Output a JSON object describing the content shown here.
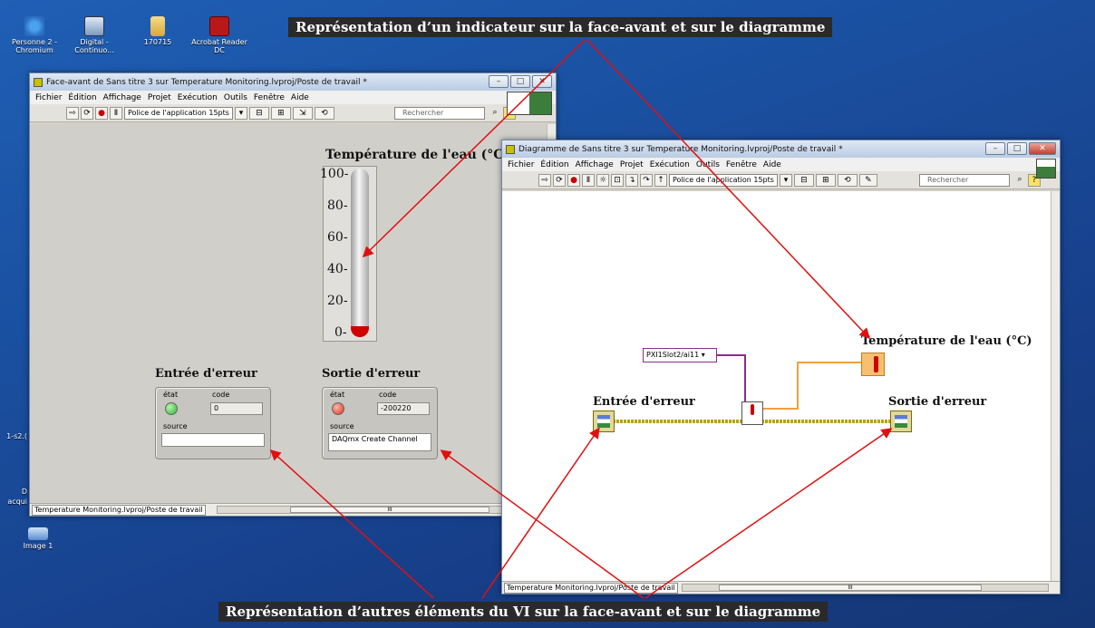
{
  "desktop": {
    "icons": [
      {
        "label": "Personne 2 - Chromium",
        "icon": "chromium-icon"
      },
      {
        "label": "Digital - Continuo...",
        "icon": "computer-icon"
      },
      {
        "label": "170715",
        "icon": "folder-icon"
      },
      {
        "label": "Acrobat Reader DC",
        "icon": "acrobat-icon"
      },
      {
        "label": "Image 1",
        "icon": "image-icon"
      }
    ],
    "edge_texts": [
      "1-s2.(",
      "D",
      "acqui"
    ]
  },
  "captions": {
    "top": "Représentation d’un indicateur sur la face-avant et sur le diagramme",
    "bottom": "Représentation d’autres éléments du VI sur la face-avant et sur le diagramme"
  },
  "front_panel": {
    "title": "Face-avant de Sans titre 3 sur Temperature Monitoring.lvproj/Poste de travail *",
    "menu": [
      "Fichier",
      "Édition",
      "Affichage",
      "Projet",
      "Exécution",
      "Outils",
      "Fenêtre",
      "Aide"
    ],
    "font_select": "Police de l'application 15pts",
    "search_placeholder": "Rechercher",
    "thermometer": {
      "label": "Température de l'eau (°C)",
      "ticks": [
        "100-",
        "80-",
        "60-",
        "40-",
        "20-",
        "0-"
      ],
      "value": 0
    },
    "error_in": {
      "label": "Entrée d'erreur",
      "status_label": "état",
      "code_label": "code",
      "code": "0",
      "source_label": "source",
      "source": "",
      "status_color": "#2bb52b"
    },
    "error_out": {
      "label": "Sortie d'erreur",
      "status_label": "état",
      "code_label": "code",
      "code": "-200220",
      "source_label": "source",
      "source": "DAQmx Create Channel",
      "status_color": "#e03020"
    },
    "status_project": "Temperature Monitoring.lvproj/Poste de travail"
  },
  "diagram": {
    "title": "Diagramme de Sans titre 3 sur Temperature Monitoring.lvproj/Poste de travail *",
    "menu": [
      "Fichier",
      "Édition",
      "Affichage",
      "Projet",
      "Exécution",
      "Outils",
      "Fenêtre",
      "Aide"
    ],
    "font_select": "Police de l'application 15pts",
    "search_placeholder": "Rechercher",
    "channel_constant": "PXI1Slot2/ai11",
    "temp_label": "Température de l'eau (°C)",
    "error_in_label": "Entrée d'erreur",
    "error_out_label": "Sortie d'erreur",
    "status_project": "Temperature Monitoring.lvproj/Poste de travail"
  },
  "colors": {
    "arrow": "#e01010",
    "wire_error": "#b5a400",
    "wire_dbl": "#f0a040",
    "wire_task": "#8a2c8a"
  }
}
